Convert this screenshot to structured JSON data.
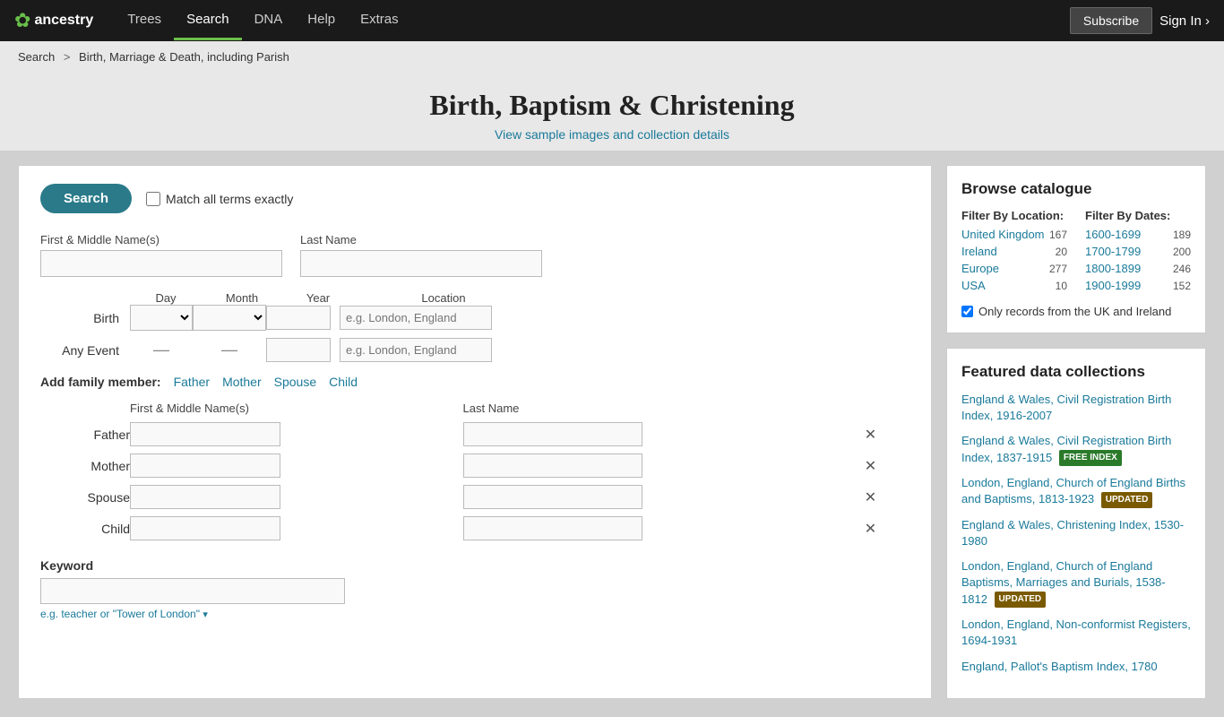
{
  "nav": {
    "logo_leaf": "✿",
    "brand": "ancestry",
    "links": [
      {
        "label": "Trees",
        "active": false
      },
      {
        "label": "Search",
        "active": true
      },
      {
        "label": "DNA",
        "active": false
      },
      {
        "label": "Help",
        "active": false
      },
      {
        "label": "Extras",
        "active": false
      }
    ],
    "subscribe_label": "Subscribe",
    "signin_label": "Sign In ›"
  },
  "breadcrumb": {
    "search_label": "Search",
    "separator": ">",
    "current": "Birth, Marriage & Death, including Parish"
  },
  "page": {
    "title": "Birth, Baptism & Christening",
    "subtitle": "View sample images and collection details"
  },
  "search": {
    "button_label": "Search",
    "match_label": "Match all terms exactly",
    "first_name_label": "First & Middle Name(s)",
    "first_name_placeholder": "",
    "last_name_label": "Last Name",
    "last_name_placeholder": "",
    "birth_label": "Birth",
    "any_event_label": "Any Event",
    "day_label": "Day",
    "month_label": "Month",
    "year_label": "Year",
    "location_label": "Location",
    "location_placeholder_1": "e.g. London, England",
    "location_placeholder_2": "e.g. London, England",
    "add_family_label": "Add family member:",
    "family_links": [
      "Father",
      "Mother",
      "Spouse",
      "Child"
    ],
    "family_col_first": "First & Middle Name(s)",
    "family_col_last": "Last Name",
    "family_rows": [
      {
        "label": "Father"
      },
      {
        "label": "Mother"
      },
      {
        "label": "Spouse"
      },
      {
        "label": "Child"
      }
    ],
    "keyword_label": "Keyword",
    "keyword_placeholder": "",
    "keyword_hint": "e.g. teacher or \"Tower of London\""
  },
  "catalogue": {
    "title": "Browse catalogue",
    "filter_location_title": "Filter By Location:",
    "filter_dates_title": "Filter By Dates:",
    "locations": [
      {
        "label": "United Kingdom",
        "count": "167"
      },
      {
        "label": "Ireland",
        "count": "20"
      },
      {
        "label": "Europe",
        "count": "277"
      },
      {
        "label": "USA",
        "count": "10"
      }
    ],
    "dates": [
      {
        "label": "1600-1699",
        "count": "189"
      },
      {
        "label": "1700-1799",
        "count": "200"
      },
      {
        "label": "1800-1899",
        "count": "246"
      },
      {
        "label": "1900-1999",
        "count": "152"
      }
    ],
    "only_uk_label": "Only records from the UK and Ireland"
  },
  "featured": {
    "title": "Featured data collections",
    "items": [
      {
        "label": "England & Wales, Civil Registration Birth Index, 1916-2007",
        "badge": null
      },
      {
        "label": "England & Wales, Civil Registration Birth Index, 1837-1915",
        "badge": "FREE INDEX"
      },
      {
        "label": "London, England, Church of England Births and Baptisms, 1813-1923",
        "badge": "UPDATED"
      },
      {
        "label": "England & Wales, Christening Index, 1530-1980",
        "badge": null
      },
      {
        "label": "London, England, Church of England Baptisms, Marriages and Burials, 1538-1812",
        "badge": "UPDATED"
      },
      {
        "label": "London, England, Non-conformist Registers, 1694-1931",
        "badge": null
      },
      {
        "label": "England, Pallot's Baptism Index, 1780",
        "badge": null
      }
    ]
  }
}
